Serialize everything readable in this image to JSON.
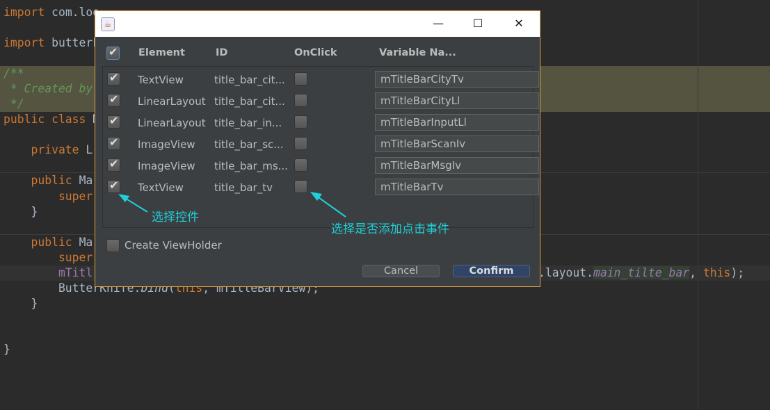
{
  "editor": {
    "lines": [
      {
        "kw": "import ",
        "rest": "com.loo"
      },
      {
        "kw": "import ",
        "rest": "butterk"
      },
      {
        "doc1": "/**"
      },
      {
        "doc2": " * Created by"
      },
      {
        "doc3": " */"
      },
      {
        "kw": "public class ",
        "rest": "M"
      },
      {
        "kw": "    private ",
        "rest": "L"
      },
      {
        "kw": "    public ",
        "rest": "Ma"
      },
      {
        "kw": "        super"
      },
      {
        "rest": "    }"
      },
      {
        "kw": "    public ",
        "rest": "Ma"
      },
      {
        "kw": "        super"
      },
      {
        "pu": "        mTitl"
      },
      {
        "rest": "        ButterKnife.",
        "it": "bind",
        "rest2": "(",
        "kw2": "this",
        "rest3": ", mTitleBarView);"
      },
      {
        "rest": "    }"
      },
      {
        "rest": "}"
      }
    ],
    "tail": {
      "a": ".layout.",
      "b": "main_tilte_bar",
      "c": ", ",
      "d": "this",
      "e": ");"
    }
  },
  "dialog": {
    "icon": "java-cup-icon",
    "controls": {
      "minimize": "—",
      "maximize": "☐",
      "close": "✕"
    },
    "headers": {
      "element": "Element",
      "id": "ID",
      "onclick": "OnClick",
      "variable": "Variable Na..."
    },
    "select_all_checked": true,
    "rows": [
      {
        "element": "TextView",
        "id": "title_bar_cit...",
        "checked": true,
        "onclick": false,
        "variable": "mTitleBarCityTv"
      },
      {
        "element": "LinearLayout",
        "id": "title_bar_cit...",
        "checked": true,
        "onclick": false,
        "variable": "mTitleBarCityLl"
      },
      {
        "element": "LinearLayout",
        "id": "title_bar_in...",
        "checked": true,
        "onclick": false,
        "variable": "mTitleBarInputLl"
      },
      {
        "element": "ImageView",
        "id": "title_bar_sc...",
        "checked": true,
        "onclick": false,
        "variable": "mTitleBarScanIv"
      },
      {
        "element": "ImageView",
        "id": "title_bar_ms...",
        "checked": true,
        "onclick": false,
        "variable": "mTitleBarMsgIv"
      },
      {
        "element": "TextView",
        "id": "title_bar_tv",
        "checked": true,
        "onclick": false,
        "variable": "mTitleBarTv"
      }
    ],
    "viewholder": {
      "label": "Create ViewHolder",
      "checked": false
    },
    "cancel": "Cancel",
    "confirm": "Confirm"
  },
  "annotations": {
    "select_control": "选择控件",
    "select_onclick": "选择是否添加点击事件",
    "color": "#1ed0d8"
  }
}
